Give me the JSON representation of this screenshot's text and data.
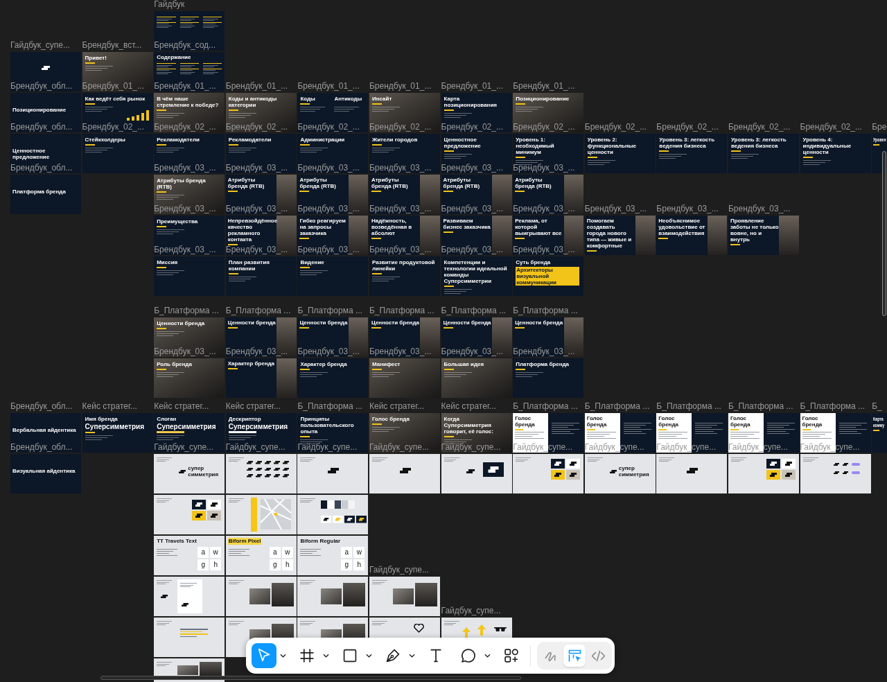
{
  "canvas": {
    "groups": [
      {
        "rows": [
          {
            "frames": [
              {
                "label": "Гайдбук",
                "kind": "contents"
              }
            ]
          },
          {
            "frames": [
              {
                "label": "Гайдбук_супе...",
                "kind": "cover"
              },
              {
                "label": "Брендбук_вст...",
                "kind": "photo",
                "title": "Привет!"
              },
              {
                "label": "Брендбук_сод...",
                "kind": "contents",
                "title": "Содержание"
              }
            ]
          },
          {
            "frames": [
              {
                "label": "Брендбук_обл...",
                "kind": "section",
                "title": "Позиционирование"
              },
              {
                "label": "Брендбук_01_...",
                "kind": "chart",
                "title": "Как ведёт себя рынок"
              },
              {
                "label": "Брендбук_01_...",
                "kind": "photo",
                "title": "В чём наше стремление к победе?"
              },
              {
                "label": "Брендбук_01_...",
                "kind": "photo",
                "title": "Коды и антикоды категории"
              },
              {
                "label": "Брендбук_01_...",
                "kind": "dark",
                "title": "Коды",
                "title_2": "Антикоды"
              },
              {
                "label": "Брендбук_01_...",
                "kind": "photo",
                "title": "Инсайт"
              },
              {
                "label": "Брендбук_01_...",
                "kind": "dark",
                "title": "Карта позиционирования"
              },
              {
                "label": "Брендбук_01_...",
                "kind": "photo",
                "title": "Позиционирование"
              }
            ]
          },
          {
            "frames": [
              {
                "label": "Брендбук_обл...",
                "kind": "section",
                "title": "Ценностное предложение"
              },
              {
                "label": "Брендбук_02_...",
                "kind": "dark",
                "title": "Стейкхолдеры"
              },
              {
                "label": "Брендбук_02_...",
                "kind": "dark",
                "title": "Рекламодатели"
              },
              {
                "label": "Брендбук_02_...",
                "kind": "dark",
                "title": "Рекламодатели"
              },
              {
                "label": "Брендбук_02_...",
                "kind": "dark",
                "title": "Администрации"
              },
              {
                "label": "Брендбук_02_...",
                "kind": "dark",
                "title": "Жители городов"
              },
              {
                "label": "Брендбук_02_...",
                "kind": "dark",
                "title": "Ценностное предложение"
              },
              {
                "label": "Брендбук_02_...",
                "kind": "dark",
                "title": "Уровень 1: необходимый минимум"
              },
              {
                "label": "Брендбук_02_...",
                "kind": "dark",
                "title": "Уровень 2: функциональные ценности"
              },
              {
                "label": "Брендбук_02_...",
                "kind": "dark",
                "title": "Уровень 3: легкость ведения бизнеса"
              },
              {
                "label": "Брендбук_02_...",
                "kind": "dark",
                "title": "Уровень 3: легкость ведения бизнеса"
              },
              {
                "label": "Брендбук_02_...",
                "kind": "dark",
                "title": "Уровень 4: индивидуальные ценности"
              },
              {
                "label": "Бре",
                "kind": "dark",
                "title": "Уровен"
              }
            ]
          },
          {
            "frames": [
              {
                "label": "Брендбук_обл...",
                "kind": "section",
                "title": "Платформа бренда"
              },
              {
                "label": "Брендбук_03_...",
                "kind": "photo",
                "title": "Атрибуты бренда (RTB)"
              },
              {
                "label": "Брендбук_03_...",
                "kind": "split",
                "title": "Атрибуты бренда (RTB)"
              },
              {
                "label": "Брендбук_03_...",
                "kind": "split",
                "title": "Атрибуты бренда (RTB)"
              },
              {
                "label": "Брендбук_03_...",
                "kind": "split",
                "title": "Атрибуты бренда (RTB)"
              },
              {
                "label": "Брендбук_03_...",
                "kind": "split",
                "title": "Атрибуты бренда (RTB)"
              },
              {
                "label": "Брендбук_03_...",
                "kind": "split",
                "title": "Атрибуты бренда (RTB)"
              }
            ]
          },
          {
            "frames": [
              {
                "label": "Брендбук_03_...",
                "kind": "dark",
                "title": "Преимущества"
              },
              {
                "label": "Брендбук_03_...",
                "kind": "split",
                "title": "Непревзойдённое качество рекламного контакта"
              },
              {
                "label": "Брендбук_03_...",
                "kind": "split",
                "title": "Гибко реагируем на запросы заказчика"
              },
              {
                "label": "Брендбук_03_...",
                "kind": "split",
                "title": "Надёжность, возведённая в абсолют"
              },
              {
                "label": "Брендбук_03_...",
                "kind": "split",
                "title": "Развиваем бизнес заказчика"
              },
              {
                "label": "Брендбук_03_...",
                "kind": "split",
                "title": "Реклама, от которой выигрывают все"
              },
              {
                "label": "Брендбук_03_...",
                "kind": "split",
                "title": "Помогаем создавать города нового типа — живые и комфортные"
              },
              {
                "label": "Брендбук_03_...",
                "kind": "split",
                "title": "Необъяснимое удовольствие от взаимодействия"
              },
              {
                "label": "Брендбук_03_...",
                "kind": "split",
                "title": "Проявление заботы не только вовне, но и внутрь"
              }
            ]
          },
          {
            "frames": [
              {
                "label": "Брендбук_03_...",
                "kind": "dark",
                "title": "Миссия"
              },
              {
                "label": "Брендбук_03_...",
                "kind": "dark",
                "title": "План развития компании"
              },
              {
                "label": "Брендбук_03_...",
                "kind": "dark",
                "title": "Видение"
              },
              {
                "label": "Брендбук_03_...",
                "kind": "dark",
                "title": "Развитие продуктовой линейки"
              },
              {
                "label": "Брендбук_03_...",
                "kind": "dark",
                "title": "Компетенции и технологии идеальной команды Суперсимметрии"
              },
              {
                "label": "Брендбук_03_...",
                "kind": "dark",
                "title": "Суть бренда",
                "highlight": "Архитекторы визуальной коммуникации"
              }
            ]
          }
        ]
      },
      {
        "rows": [
          {
            "frames": [
              {
                "label": "Б_Платформа ...",
                "kind": "photo",
                "title": "Ценности бренда"
              },
              {
                "label": "Б_Платформа ...",
                "kind": "split",
                "title": "Ценности бренда"
              },
              {
                "label": "Б_Платформа ...",
                "kind": "split",
                "title": "Ценности бренда"
              },
              {
                "label": "Б_Платформа ...",
                "kind": "split",
                "title": "Ценности бренда"
              },
              {
                "label": "Б_Платформа ...",
                "kind": "split",
                "title": "Ценности бренда"
              },
              {
                "label": "Б_Платформа ...",
                "kind": "split",
                "title": "Ценности бренда"
              }
            ]
          },
          {
            "frames": [
              {
                "label": "Брендбук_03_...",
                "kind": "photo",
                "title": "Роль бренда"
              },
              {
                "label": "Брендбук_03_...",
                "kind": "split",
                "title": "Характер бренда"
              },
              {
                "label": "Брендбук_03_...",
                "kind": "dark",
                "title": "Характер бренда"
              },
              {
                "label": "Брендбук_03_...",
                "kind": "photo",
                "title": "Манифест"
              },
              {
                "label": "Брендбук_03_...",
                "kind": "photo",
                "title": "Большая идея"
              },
              {
                "label": "Брендбук_03_...",
                "kind": "dark",
                "title": "Платформа бренда"
              }
            ]
          }
        ]
      },
      {
        "rows": [
          {
            "frames": [
              {
                "label": "Брендбук_обл...",
                "kind": "section",
                "title": "Вербальная айдентика"
              },
              {
                "label": "Кейс стратег...",
                "kind": "dark",
                "title": "Имя бренда",
                "big": "Суперсимметрия"
              },
              {
                "label": "Кейс стратег...",
                "kind": "dark",
                "title": "Слоган",
                "big": "Суперсимметрия",
                "tag": {
                  "color": "#f2c94c"
                }
              },
              {
                "label": "Кейс стратег...",
                "kind": "dark",
                "title": "Дескриптор",
                "big": "Суперсимметрия",
                "tag": {
                  "color": "#ffffff"
                }
              },
              {
                "label": "Б_Платформа ...",
                "kind": "dark",
                "title": "Принципы пользовательского опыта"
              },
              {
                "label": "Кейс стратег...",
                "kind": "photo",
                "title": "Голос бренда"
              },
              {
                "label": "Кейс стратег...",
                "kind": "photo",
                "title": "Когда Суперсимметрия говорит, её голос:"
              },
              {
                "label": "Б_Платформа ...",
                "kind": "white_split",
                "title": "Голос бренда"
              },
              {
                "label": "Б_Платформа ...",
                "kind": "white_split",
                "title": "Голос бренда"
              },
              {
                "label": "Б_Платформа ...",
                "kind": "white_split",
                "title": "Голос бренда"
              },
              {
                "label": "Б_Платформа ...",
                "kind": "white_split",
                "title": "Голос бренда"
              },
              {
                "label": "Б_Платформа ...",
                "kind": "white_split",
                "title": "Голос бренда"
              },
              {
                "label": "Б_",
                "kind": "dark",
                "title": "Карта комму"
              }
            ]
          },
          {
            "frames": [
              {
                "label": "Брендбук_обл...",
                "kind": "section",
                "title": "Визуальная айдентика"
              },
              {
                "label": "Гайдбук_супе...",
                "kind": "light_wordmark",
                "logo_text": "супер симметрия"
              },
              {
                "label": "Гайдбук_супе...",
                "kind": "light_pattern"
              },
              {
                "label": "Гайдбук_супе...",
                "kind": "light_mark"
              },
              {
                "label": "Гайдбук_супе...",
                "kind": "light_mark"
              },
              {
                "label": "Гайдбук_супе...",
                "kind": "light_mark_tile"
              },
              {
                "label": "Гайдбук_супе...",
                "kind": "light_tiles"
              },
              {
                "label": "Гайдбук_супе...",
                "kind": "light_wordmark",
                "logo_text": "супер симметрия"
              },
              {
                "label": "Гайдбук_супе...",
                "kind": "light_mark"
              },
              {
                "label": "Гайдбук_супе...",
                "kind": "light_tiles"
              },
              {
                "label": "Гайдбук_супе...",
                "kind": "light_rows"
              }
            ]
          },
          {
            "frames": [
              {
                "kind": "light_tiles"
              },
              {
                "kind": "light_map"
              },
              {
                "kind": "light_swatches"
              }
            ]
          },
          {
            "frames": [
              {
                "kind": "specimen",
                "title": "TT Travels Text",
                "highlighted": false,
                "glyphs": [
                  "a",
                  "w",
                  "g",
                  "h"
                ]
              },
              {
                "kind": "specimen",
                "title": "Biform Pixel",
                "highlighted": true,
                "glyphs": [
                  "a",
                  "w",
                  "g",
                  "h"
                ]
              },
              {
                "kind": "specimen",
                "title": "Biform Regular",
                "highlighted": false,
                "glyphs": [
                  "a",
                  "w",
                  "g",
                  "h"
                ]
              }
            ]
          },
          {
            "frames": [
              {
                "kind": "light_page"
              },
              {
                "kind": "light_photos"
              },
              {
                "kind": "light_photos"
              },
              {
                "label": "Гайдбук_супе...",
                "kind": "light_photos"
              }
            ]
          },
          {
            "frames": [
              {
                "kind": "light_text"
              },
              {
                "kind": "light_photos"
              },
              {
                "kind": "light_photos"
              },
              {
                "kind": "light_heart"
              },
              {
                "label": "Гайдбук_супе...",
                "kind": "light_arrows"
              }
            ]
          },
          {
            "frames": [
              {
                "kind": "light_photos"
              }
            ]
          }
        ]
      }
    ]
  },
  "toolbar": {
    "tools": [
      {
        "kind": "move",
        "selected": true,
        "menu": true
      },
      {
        "kind": "frame",
        "selected": false,
        "menu": true
      },
      {
        "kind": "shape",
        "selected": false,
        "menu": true
      },
      {
        "kind": "pen",
        "selected": false,
        "menu": true
      },
      {
        "kind": "text",
        "selected": false,
        "menu": false
      },
      {
        "kind": "comment",
        "selected": false,
        "menu": true
      },
      {
        "kind": "actions",
        "selected": false,
        "menu": false
      }
    ],
    "modes": [
      {
        "kind": "draw",
        "selected": false
      },
      {
        "kind": "design",
        "selected": true
      },
      {
        "kind": "dev",
        "selected": false
      }
    ]
  }
}
